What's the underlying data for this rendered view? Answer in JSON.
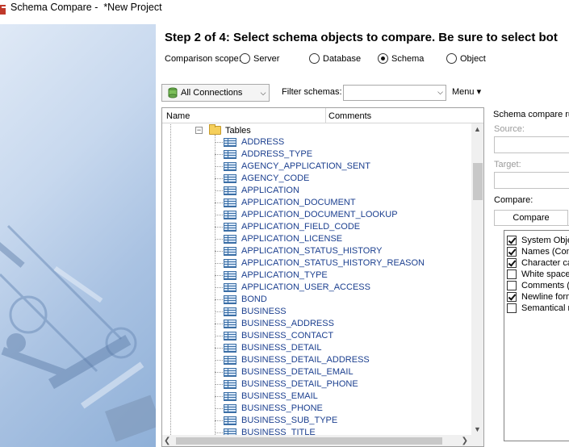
{
  "window": {
    "title": "Schema Compare -  *New Project"
  },
  "wizard": {
    "heading": "Step 2 of 4: Select schema objects to compare. Be sure to select bot"
  },
  "scope": {
    "label": "Comparison scope:",
    "options": [
      {
        "label": "Server",
        "selected": false
      },
      {
        "label": "Database",
        "selected": false
      },
      {
        "label": "Schema",
        "selected": true
      },
      {
        "label": "Object",
        "selected": false
      }
    ]
  },
  "toolbar": {
    "connections_label": "All Connections",
    "filter_label": "Filter schemas:",
    "filter_value": "",
    "menu_label": "Menu ▾"
  },
  "tree": {
    "col_name": "Name",
    "col_comments": "Comments",
    "folder_label": "Tables",
    "items": [
      "ADDRESS",
      "ADDRESS_TYPE",
      "AGENCY_APPLICATION_SENT",
      "AGENCY_CODE",
      "APPLICATION",
      "APPLICATION_DOCUMENT",
      "APPLICATION_DOCUMENT_LOOKUP",
      "APPLICATION_FIELD_CODE",
      "APPLICATION_LICENSE",
      "APPLICATION_STATUS_HISTORY",
      "APPLICATION_STATUS_HISTORY_REASON",
      "APPLICATION_TYPE",
      "APPLICATION_USER_ACCESS",
      "BOND",
      "BUSINESS",
      "BUSINESS_ADDRESS",
      "BUSINESS_CONTACT",
      "BUSINESS_DETAIL",
      "BUSINESS_DETAIL_ADDRESS",
      "BUSINESS_DETAIL_EMAIL",
      "BUSINESS_DETAIL_PHONE",
      "BUSINESS_EMAIL",
      "BUSINESS_PHONE",
      "BUSINESS_SUB_TYPE",
      "BUSINESS_TITLE"
    ]
  },
  "rules": {
    "title": "Schema compare ru",
    "source_label": "Source:",
    "target_label": "Target:",
    "compare_label": "Compare:",
    "tab_label": "Compare",
    "options": [
      {
        "label": "System Obje",
        "checked": true
      },
      {
        "label": "Names (Cons",
        "checked": true
      },
      {
        "label": "Character ca",
        "checked": true
      },
      {
        "label": "White spaces",
        "checked": false
      },
      {
        "label": "Comments (D",
        "checked": false
      },
      {
        "label": "Newline form",
        "checked": true
      },
      {
        "label": "Semantical na",
        "checked": false
      }
    ]
  }
}
